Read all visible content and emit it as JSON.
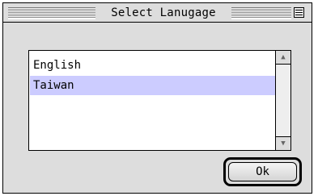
{
  "window": {
    "title": "Select Lanugage"
  },
  "language_list": {
    "items": [
      {
        "label": "English",
        "selected": false
      },
      {
        "label": "Taiwan",
        "selected": true
      }
    ],
    "selected_color": "#ccccff"
  },
  "scrollbar": {
    "up_icon": "triangle-up",
    "down_icon": "triangle-down",
    "up_glyph": "▲",
    "down_glyph": "▼"
  },
  "buttons": {
    "ok_label": "Ok"
  }
}
